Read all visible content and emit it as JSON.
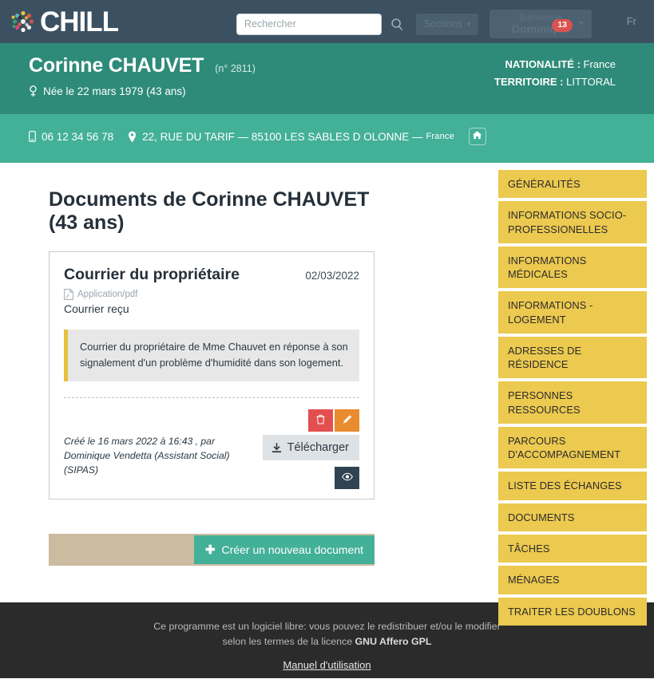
{
  "topnav": {
    "brand": "CHILL",
    "brand_logo_icon": "chill-pinwheel-logo",
    "search": {
      "placeholder": "Rechercher",
      "value": ""
    },
    "search_icon": "search-icon",
    "sections_label": "Sections",
    "user": {
      "welcome": "Bienvenue",
      "name": "Dominique",
      "badge": "13"
    },
    "language": "Fr",
    "colors": {
      "background": "#3b5161",
      "badge": "#d9534f"
    }
  },
  "person_banner": {
    "name": "Corinne CHAUVET",
    "number": "(n° 2811)",
    "gender_icon": "female-gender-icon",
    "birth": "Née le 22 mars 1979  (43 ans)",
    "nationality_label": "NATIONALITÉ :",
    "nationality_value": "France",
    "territory_label": "TERRITOIRE :",
    "territory_value": "LITTORAL",
    "colors": {
      "background": "#2e8b79"
    }
  },
  "contact_banner": {
    "phone_icon": "mobile-phone-icon",
    "phone": "06 12 34 56 78",
    "address_icon": "map-marker-icon",
    "address": "22, RUE DU TARIF — 85100 LES SABLES D OLONNE —",
    "address_country": "France",
    "home_icon": "home-icon",
    "colors": {
      "background": "#43b098"
    }
  },
  "main": {
    "page_title": "Documents de Corinne CHAUVET (43 ans)",
    "document": {
      "title": "Courrier du propriétaire",
      "date": "02/03/2022",
      "mime_icon": "pdf-file-icon",
      "mime": "Application/pdf",
      "subtitle": "Courrier reçu",
      "description": "Courrier du propriétaire de Mme Chauvet en réponse à son signalement d'un problème d'humidité dans son logement.",
      "meta": "Créé le 16 mars 2022 à 16:43 , par Dominique Vendetta (Assistant Social) (SIPAS)",
      "actions": {
        "delete_icon": "trash-icon",
        "edit_icon": "pencil-icon",
        "download_icon": "download-icon",
        "download_label": "Télécharger",
        "view_icon": "eye-icon"
      },
      "colors": {
        "delete": "#e34f4f",
        "edit": "#e98b2f",
        "download": "#dfe2e5",
        "view": "#2f4353",
        "quote_accent": "#e8c03f"
      }
    },
    "create_bar": {
      "plus_icon": "plus-icon",
      "label": "Créer un nouveau document",
      "colors": {
        "bar": "#cbbb9f",
        "button": "#43b098"
      }
    }
  },
  "sidebar": {
    "color": "#ecc94f",
    "items": [
      {
        "label": "GÉNÉRALITÉS"
      },
      {
        "label": "INFORMATIONS SOCIO-PROFESSIONELLES"
      },
      {
        "label": "INFORMATIONS MÉDICALES"
      },
      {
        "label": "INFORMATIONS - LOGEMENT"
      },
      {
        "label": "ADRESSES DE RÉSIDENCE"
      },
      {
        "label": "PERSONNES RESSOURCES"
      },
      {
        "label": "PARCOURS D'ACCOMPAGNEMENT"
      },
      {
        "label": "LISTE DES ÉCHANGES"
      },
      {
        "label": "DOCUMENTS"
      },
      {
        "label": "TÂCHES"
      },
      {
        "label": "MÉNAGES"
      },
      {
        "label": "TRAITER LES DOUBLONS"
      }
    ]
  },
  "footer": {
    "line1": "Ce programme est un logiciel libre: vous pouvez le redistribuer et/ou le modifier",
    "line2_prefix": "selon les termes de la licence ",
    "license": "GNU Affero GPL",
    "manual_link": "Manuel d'utilisation"
  }
}
